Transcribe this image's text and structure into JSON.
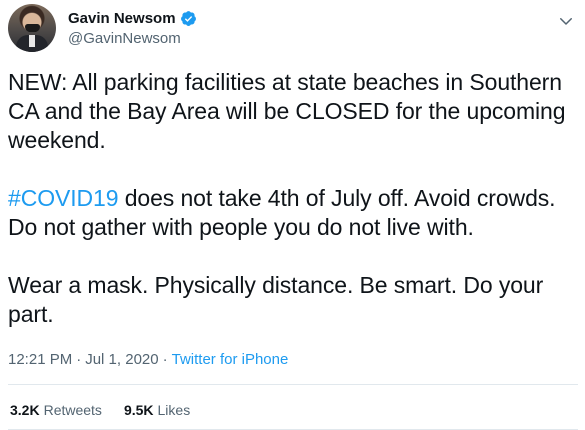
{
  "author": {
    "display_name": "Gavin Newsom",
    "handle": "@GavinNewsom",
    "verified": true
  },
  "tweet": {
    "paragraph_1": "NEW: All parking facilities at state beaches in Southern CA and the Bay Area will be CLOSED for the upcoming weekend.",
    "hashtag": "#COVID19",
    "paragraph_2_rest": " does not take 4th of July off. Avoid crowds. Do not gather with people you do not live with.",
    "paragraph_3": "Wear a mask. Physically distance. Be smart. Do your part."
  },
  "meta": {
    "time": "12:21 PM",
    "separator": "·",
    "date": "Jul 1, 2020",
    "source": "Twitter for iPhone"
  },
  "stats": {
    "retweets_count": "3.2K",
    "retweets_label": "Retweets",
    "likes_count": "9.5K",
    "likes_label": "Likes"
  },
  "colors": {
    "link": "#1d9bf0",
    "secondary_text": "#536471",
    "primary_text": "#0f1419"
  },
  "icons": {
    "verified": "verified-badge-icon",
    "more": "chevron-down-icon"
  }
}
